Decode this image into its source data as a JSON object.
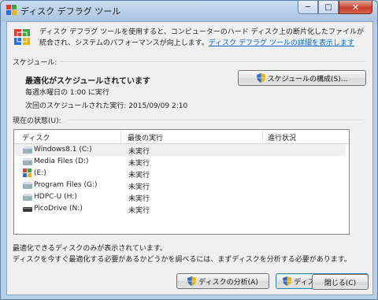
{
  "window": {
    "title": "ディスク デフラグ ツール",
    "controls": {
      "minimize": "─",
      "maximize": "□",
      "close": "✕"
    }
  },
  "intro": {
    "text": "ディスク デフラグ ツールを使用すると、コンピューターのハード ディスク上の断片化したファイルが統合され、システムのパフォーマンスが向上します。",
    "link": "ディスク デフラグ ツールの詳細を表示します"
  },
  "schedule": {
    "section_label": "スケジュール:",
    "status": "最適化がスケジュールされています",
    "frequency": "毎週水曜日の 1:00 に実行",
    "next_run": "次回のスケジュールされた実行: 2015/09/09 2:10",
    "configure_button": "スケジュールの構成(S)..."
  },
  "current_status": {
    "section_label": "現在の状態(U):",
    "columns": [
      "ディスク",
      "最後の実行",
      "進行状況"
    ],
    "disks": [
      {
        "name": "Windows8.1 (C:)",
        "last_run": "未実行",
        "progress": "",
        "icon": "hard-drive-icon"
      },
      {
        "name": "Media Files (D:)",
        "last_run": "未実行",
        "progress": "",
        "icon": "hard-drive-icon"
      },
      {
        "name": "(E:)",
        "last_run": "未実行",
        "progress": "",
        "icon": "windows-drive-icon"
      },
      {
        "name": "Program Files (G:)",
        "last_run": "未実行",
        "progress": "",
        "icon": "hard-drive-icon"
      },
      {
        "name": "HDPC-U (H:)",
        "last_run": "未実行",
        "progress": "",
        "icon": "hard-drive-icon"
      },
      {
        "name": "PicoDrive (N:)",
        "last_run": "未実行",
        "progress": "",
        "icon": "usb-drive-icon"
      }
    ]
  },
  "footer": {
    "note_1": "最適化できるディスクのみが表示されています。",
    "note_2": "ディスクを今すぐ最適化する必要があるかどうかを調べるには、まずディスクを分析する必要があります。",
    "analyze_button": "ディスクの分析(A)",
    "defrag_button": "ディスクの最適化(D)",
    "close_button": "閉じる(C)"
  },
  "colors": {
    "link": "#0066cc",
    "close_button": "#c6402d",
    "title_bar": "#a9c4e3"
  }
}
